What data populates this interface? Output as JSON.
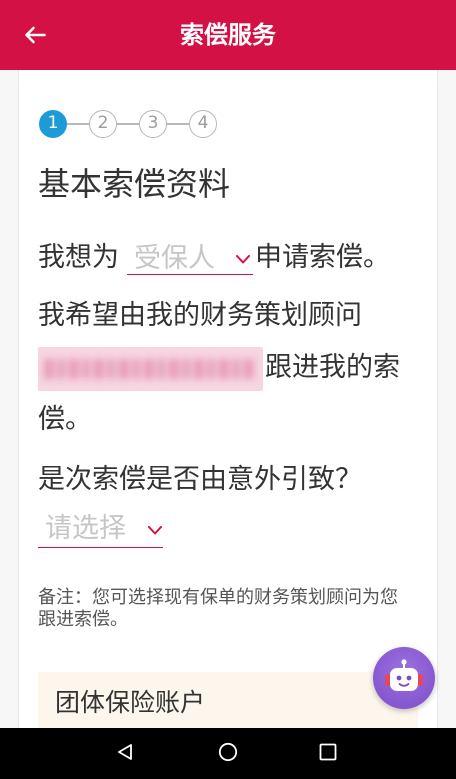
{
  "header": {
    "title": "索偿服务",
    "back_icon": "arrow-left-icon"
  },
  "steps": {
    "items": [
      "1",
      "2",
      "3",
      "4"
    ],
    "current": 1
  },
  "form": {
    "heading": "基本索偿资料",
    "claim_for": {
      "prefix": "我想为",
      "select": {
        "placeholder": "受保人",
        "icon": "chevron-down-icon"
      },
      "suffix": "申请索偿。"
    },
    "advisor": {
      "prefix": "我希望由我的财务策划顾问",
      "suffix": "跟进我的索偿。"
    },
    "accident": {
      "question": "是次索偿是否由意外引致？",
      "select": {
        "placeholder": "请选择",
        "icon": "chevron-down-icon"
      }
    },
    "note": "备注：您可选择现有保单的财务策划顾问为您跟进索偿。"
  },
  "account_section": {
    "title": "团体保险账户"
  },
  "chatbot": {
    "icon": "chatbot-icon"
  },
  "system_nav": {
    "icons": [
      "nav-back-icon",
      "nav-home-icon",
      "nav-recents-icon"
    ]
  },
  "colors": {
    "header": "#D31145",
    "accent": "#D31145",
    "step_active": "#1E9BD7",
    "placeholder": "#C6C6C6",
    "section_bg": "#FDF6EC",
    "chatbot": "#8B5FD3"
  }
}
